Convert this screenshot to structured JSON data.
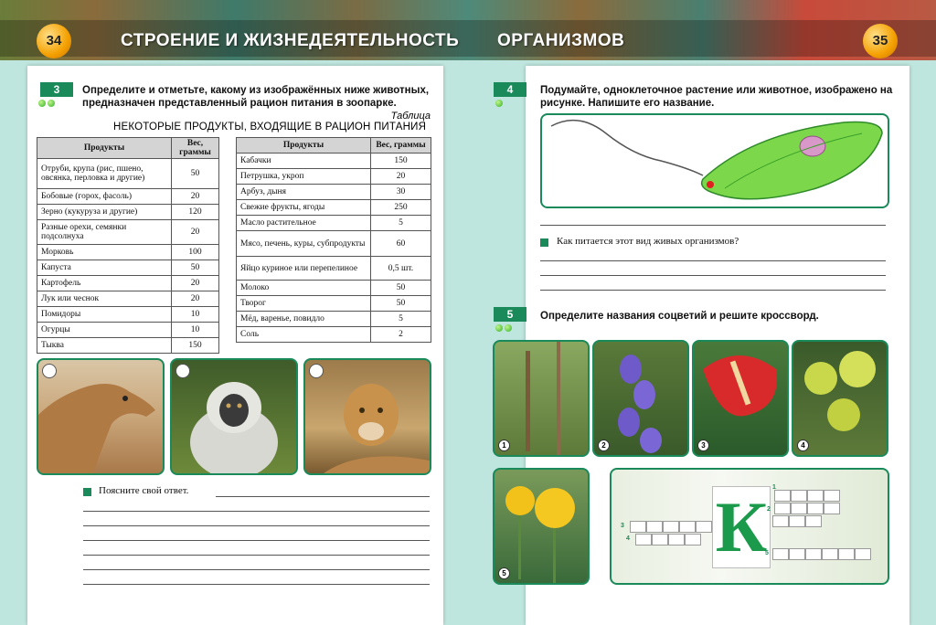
{
  "header": {
    "page_left": "34",
    "page_right": "35",
    "title_left": "СТРОЕНИЕ И ЖИЗНЕДЕЯТЕЛЬНОСТЬ",
    "title_right": "ОРГАНИЗМОВ"
  },
  "task3": {
    "number": "3",
    "text": "Определите и отметьте, какому из изображённых ниже животных, предназначен представленный рацион питания в зоопарке.",
    "table_label": "Таблица",
    "table_title": "НЕКОТОРЫЕ ПРОДУКТЫ, ВХОДЯЩИЕ В РАЦИОН ПИТАНИЯ",
    "col_product": "Продукты",
    "col_weight": "Вес, граммы",
    "left_rows": [
      [
        "Отруби, крупа (рис, пшено, овсянка, перловка и другие)",
        "50"
      ],
      [
        "Бобовые (горох, фасоль)",
        "20"
      ],
      [
        "Зерно (кукуруза и другие)",
        "120"
      ],
      [
        "Разные орехи, семянки подсолнуха",
        "20"
      ],
      [
        "Морковь",
        "100"
      ],
      [
        "Капуста",
        "50"
      ],
      [
        "Картофель",
        "20"
      ],
      [
        "Лук или чеснок",
        "20"
      ],
      [
        "Помидоры",
        "10"
      ],
      [
        "Огурцы",
        "10"
      ],
      [
        "Тыква",
        "150"
      ]
    ],
    "right_rows": [
      [
        "Кабачки",
        "150"
      ],
      [
        "Петрушка, укроп",
        "20"
      ],
      [
        "Арбуз, дыня",
        "30"
      ],
      [
        "Свежие фрукты, ягоды",
        "250"
      ],
      [
        "Масло растительное",
        "5"
      ],
      [
        "Мясо, печень, куры, субпродукты",
        "60"
      ],
      [
        "Яйцо куриное или перепелиное",
        "0,5 шт."
      ],
      [
        "Молоко",
        "50"
      ],
      [
        "Творог",
        "50"
      ],
      [
        "Мёд, варенье, повидло",
        "5"
      ],
      [
        "Соль",
        "2"
      ]
    ],
    "explain_prompt": "Поясните свой ответ."
  },
  "task4": {
    "number": "4",
    "text": "Подумайте, одноклеточное растение или животное, изображено на рисунке. Напишите его название.",
    "question": "Как питается этот вид живых организмов?"
  },
  "task5": {
    "number": "5",
    "text": "Определите названия соцветий и решите кроссворд.",
    "photo_numbers": [
      "1",
      "2",
      "3",
      "4",
      "5"
    ],
    "crossword_letter": "К",
    "crossword_numbers": [
      "1",
      "2",
      "3",
      "4",
      "5"
    ]
  },
  "colors": {
    "accent_green": "#1a8a5a",
    "page_number_orange": "#f4a000"
  }
}
